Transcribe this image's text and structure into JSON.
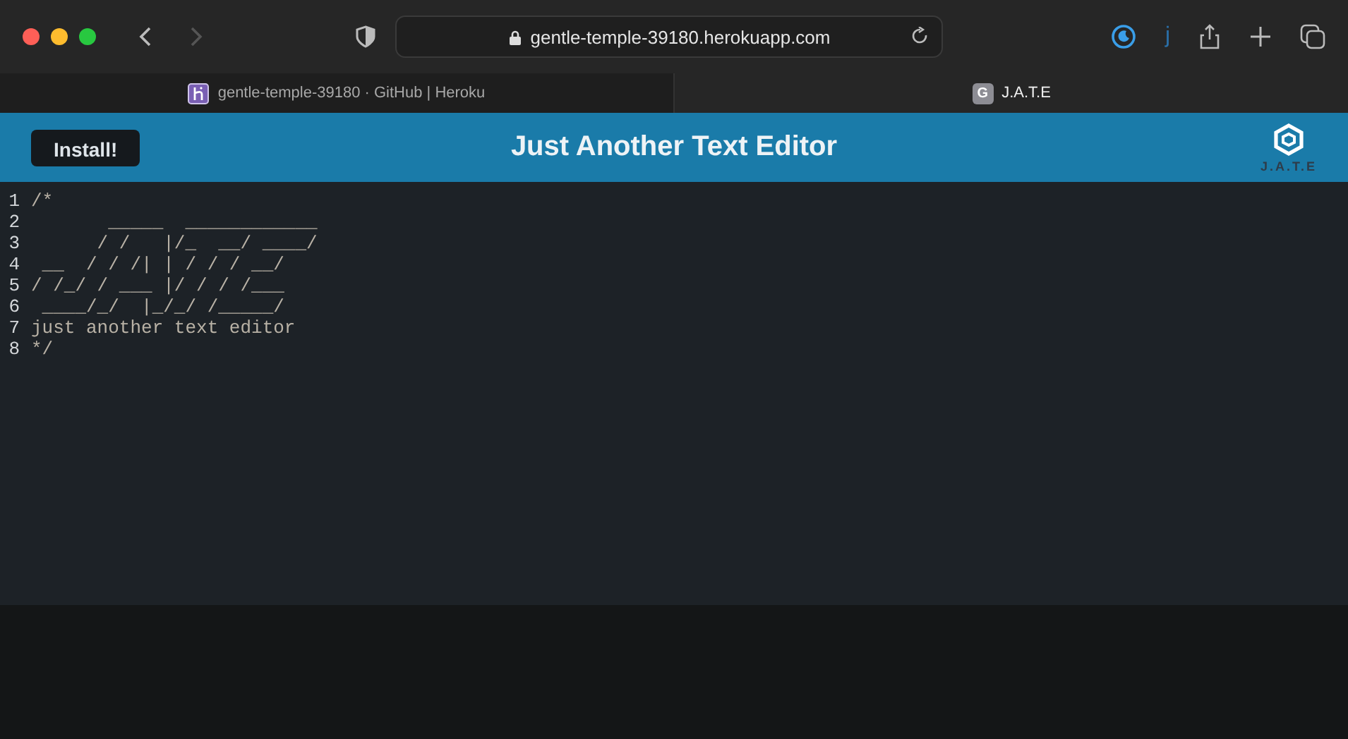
{
  "browser": {
    "url": "gentle-temple-39180.herokuapp.com",
    "profile_letter": "j",
    "tabs": [
      {
        "title": "gentle-temple-39180 · GitHub | Heroku",
        "selected": false,
        "kind": "logo"
      },
      {
        "title": "J.A.T.E",
        "selected": true,
        "kind": "letter",
        "favicon_text": "G"
      }
    ]
  },
  "header": {
    "install_button": "Install!",
    "title": "Just Another Text Editor",
    "logo_text": "J.A.T.E"
  },
  "editor": {
    "lines": [
      {
        "number": "1",
        "text": "/*"
      },
      {
        "number": "2",
        "text": "       _____  ____________"
      },
      {
        "number": "3",
        "text": "      / /   |/_  __/ ____/"
      },
      {
        "number": "4",
        "text": " __  / / /| | / / / __/"
      },
      {
        "number": "5",
        "text": "/ /_/ / ___ |/ / / /___"
      },
      {
        "number": "6",
        "text": " ____/_/  |_/_/ /_____/"
      },
      {
        "number": "7",
        "text": "just another text editor"
      },
      {
        "number": "8",
        "text": "*/"
      }
    ]
  }
}
